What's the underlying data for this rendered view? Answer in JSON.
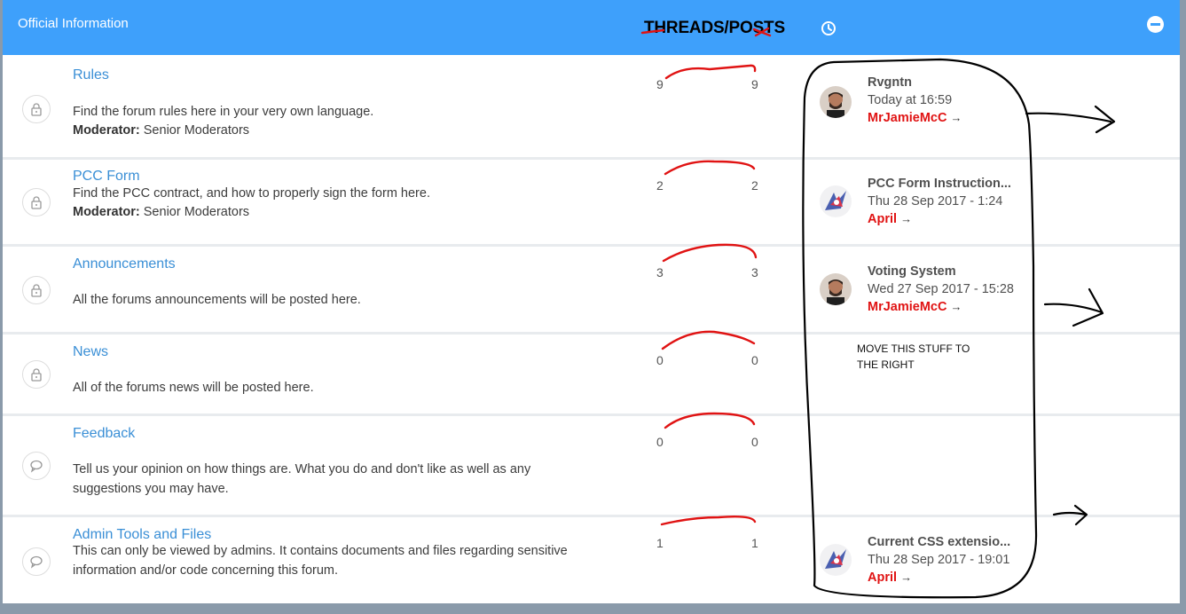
{
  "category": {
    "title": "Official Information",
    "column_header": "THREADS/POSTS",
    "clock_icon": "clock-icon",
    "collapse_icon": "minus-circle-icon"
  },
  "forums": [
    {
      "title": "Rules",
      "description": "Find the forum rules here in your very own language.",
      "moderator_label": "Moderator:",
      "moderator": "Senior Moderators",
      "icon": "lock-icon",
      "threads": "9",
      "posts": "9",
      "last_post": {
        "title": "Rvgntn",
        "date": "Today at 16:59",
        "user": "MrJamieMcC",
        "arrow": "→",
        "avatar": "man-avatar"
      }
    },
    {
      "title": "PCC Form",
      "description": "Find the PCC contract, and how to properly sign the form here.",
      "moderator_label": "Moderator:",
      "moderator": "Senior Moderators",
      "icon": "lock-icon",
      "threads": "2",
      "posts": "2",
      "last_post": {
        "title": "PCC Form Instruction...",
        "date": "Thu 28 Sep 2017 - 1:24",
        "user": "April",
        "arrow": "→",
        "avatar": "anime-avatar"
      }
    },
    {
      "title": "Announcements",
      "description": "All the forums announcements will be posted here.",
      "icon": "lock-icon",
      "threads": "3",
      "posts": "3",
      "last_post": {
        "title": "Voting System",
        "date": "Wed 27 Sep 2017 - 15:28",
        "user": "MrJamieMcC",
        "arrow": "→",
        "avatar": "man-avatar"
      }
    },
    {
      "title": "News",
      "description": "All of the forums news will be posted here.",
      "icon": "lock-icon",
      "threads": "0",
      "posts": "0"
    },
    {
      "title": "Feedback",
      "description": "Tell us your opinion on how things are. What you do and don't like as well as any suggestions you may have.",
      "icon": "speech-bubble-icon",
      "threads": "0",
      "posts": "0"
    },
    {
      "title": "Admin Tools and Files",
      "description": "This can only be viewed by admins. It contains documents and files regarding sensitive information and/or code concerning this forum.",
      "icon": "speech-bubble-icon",
      "threads": "1",
      "posts": "1",
      "last_post": {
        "title": "Current CSS extensio...",
        "date": "Thu 28 Sep 2017 - 19:01",
        "user": "April",
        "arrow": "→",
        "avatar": "anime-avatar"
      }
    }
  ],
  "annotation": {
    "note_line1": "MOVE THIS STUFF TO",
    "note_line2": "THE RIGHT",
    "ink_red": "#e01313",
    "ink_black": "#000000"
  },
  "colors": {
    "header_bg": "#3ea0fb",
    "link": "#3a8fd6",
    "username": "#e01313"
  }
}
